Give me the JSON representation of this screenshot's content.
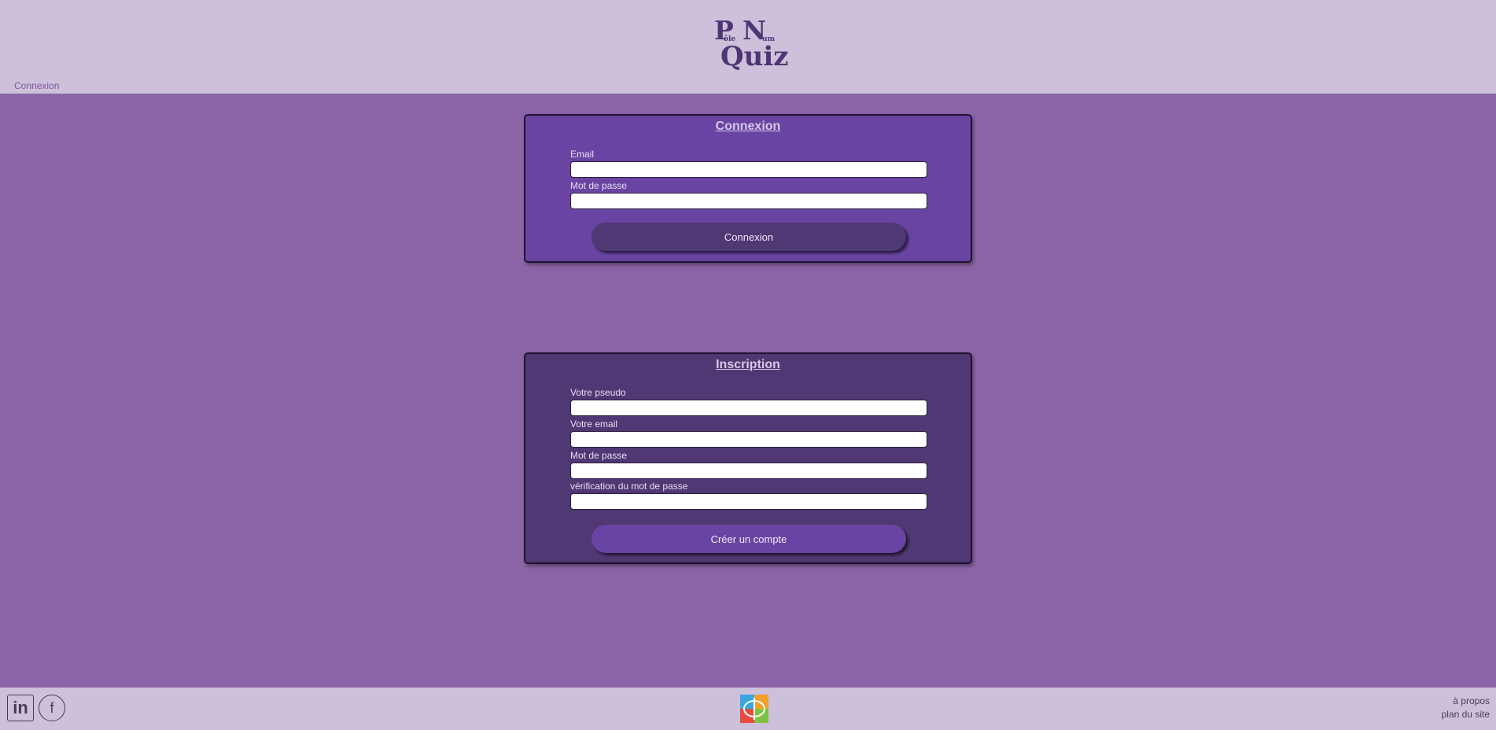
{
  "header": {
    "logo": {
      "p": "P",
      "ole": "ôle",
      "n": "N",
      "um": "um",
      "quiz": "Quiz"
    },
    "breadcrumb": "Connexion"
  },
  "login": {
    "title": "Connexion",
    "email_label": "Email",
    "password_label": "Mot de passe",
    "email_value": "",
    "password_value": "",
    "button_label": "Connexion"
  },
  "signup": {
    "title": "Inscription",
    "pseudo_label": "Votre pseudo",
    "email_label": "Votre email",
    "password_label": "Mot de passe",
    "password_confirm_label": "vérification du mot de passe",
    "pseudo_value": "",
    "email_value": "",
    "password_value": "",
    "password_confirm_value": "",
    "button_label": "Créer un compte"
  },
  "footer": {
    "social": [
      {
        "icon": "linkedin-icon",
        "label": "in"
      },
      {
        "icon": "facebook-icon",
        "label": "f"
      }
    ],
    "links": {
      "about": "à propos",
      "sitemap": "plan du site"
    }
  },
  "colors": {
    "background": "#8b64a7",
    "header_bg": "#cdc0db",
    "login_card": "#6a44a2",
    "signup_card": "#4f3873"
  }
}
